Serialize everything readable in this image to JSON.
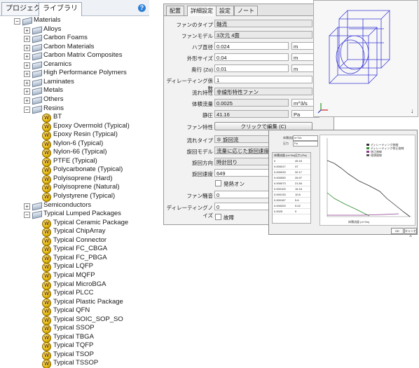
{
  "tree": {
    "tabs": [
      "プロジェクト",
      "ライブラリ"
    ],
    "active_tab": 1,
    "help_icon": "?",
    "root": "Materials",
    "categories": [
      "Alloys",
      "Carbon Foams",
      "Carbon Materials",
      "Carbon Matrix Composites",
      "Ceramics",
      "High Performance Polymers",
      "Laminates",
      "Metals",
      "Others"
    ],
    "resins": {
      "label": "Resins",
      "items": [
        "BT",
        "Epoxy Overmold (Typical)",
        "Epoxy Resin (Typical)",
        "Nylon-6 (Typical)",
        "Nylon-66 (Typical)",
        "PTFE (Typical)",
        "Polycarbonate (Typical)",
        "Polyisoprene (Hard)",
        "Polyisoprene (Natural)",
        "Polystyrene (Typical)"
      ]
    },
    "semiconductors": "Semiconductors",
    "packages": {
      "label": "Typical Lumped Packages",
      "items": [
        "Typical Ceramic Package",
        "Typical ChipArray",
        "Typical Connector",
        "Typical FC_CBGA",
        "Typical FC_PBGA",
        "Typical LQFP",
        "Typical MQFP",
        "Typical MicroBGA",
        "Typical PLCC",
        "Typical Plastic Package",
        "Typical QFN",
        "Typical SOIC_SOP_SO",
        "Typical SSOP",
        "Typical TBGA",
        "Typical TQFP",
        "Typical TSOP",
        "Typical TSSOP"
      ]
    },
    "material_badge": "W"
  },
  "props": {
    "tabs": [
      "配置",
      "詳細設定",
      "設定",
      "ノート"
    ],
    "active_tab": 1,
    "fan_type": {
      "label": "ファンのタイプ",
      "value": "軸流"
    },
    "fan_model": {
      "label": "ファンモデル",
      "value": "3次元 4面"
    },
    "hub_dia": {
      "label": "ハブ直径",
      "value": "0.024",
      "unit": "m"
    },
    "outer_size": {
      "label": "外形サイズ",
      "value": "0.04",
      "unit": "m"
    },
    "depth": {
      "label": "奥行 (Zo)",
      "value": "0.01",
      "unit": "m"
    },
    "derating": {
      "label": "ディレーティング係数",
      "value": "1"
    },
    "flow_char": {
      "label": "流れ特性",
      "value": "非線形特性ファン"
    },
    "vol_flow": {
      "label": "体積流量",
      "value": "0.0025",
      "unit": "m^3/s"
    },
    "static_p": {
      "label": "静圧",
      "value": "41.16",
      "unit": "Pa"
    },
    "fan_char": {
      "label": "ファン特性",
      "button": "クリックで編集 (C)"
    },
    "flow_type": {
      "label": "流れタイプ",
      "value": "旋回流"
    },
    "swirl_model": {
      "label": "旋回モデル",
      "value": "流量に応じた旋回速度"
    },
    "swirl_dir": {
      "label": "旋回方向",
      "value": "時計回り"
    },
    "swirl_speed": {
      "label": "旋回速度",
      "value": "649"
    },
    "heat": {
      "label": "発熱オン"
    },
    "fan_noise": {
      "label": "ファン騒音",
      "value": "0"
    },
    "derating_noise": {
      "label": "ディレーティングノイズ",
      "value": "0"
    },
    "failure": {
      "label": "故障"
    }
  },
  "curve": {
    "tiny_labels": [
      "体積流量",
      "m^3/s",
      "圧力",
      "Pa"
    ],
    "table_headers": [
      "体積流量 (m^3/s)",
      "圧力 (Pa)"
    ],
    "table_rows": [
      [
        "0",
        "45.16"
      ],
      [
        "0.000017",
        "37"
      ],
      [
        "0.000033",
        "32.17"
      ],
      [
        "0.000050",
        "26.97"
      ],
      [
        "0.000073",
        "21.84"
      ],
      [
        "0.000100",
        "16.16"
      ],
      [
        "0.000133",
        "10.8"
      ],
      [
        "0.000167",
        "5.6"
      ],
      [
        "0.000200",
        "5.02"
      ],
      [
        "0.0025",
        "0"
      ]
    ],
    "legend": [
      "ディレーティング曲線",
      "ディレーティング修正曲線",
      "修正曲線",
      "理想曲線"
    ],
    "legend_colors": [
      "#333333",
      "#2e8b2e",
      "#8b3a8b",
      "#555555"
    ],
    "buttons": [
      "OK",
      "キャンセル"
    ],
    "xlabel": "体積流量 (m^3/s)"
  }
}
